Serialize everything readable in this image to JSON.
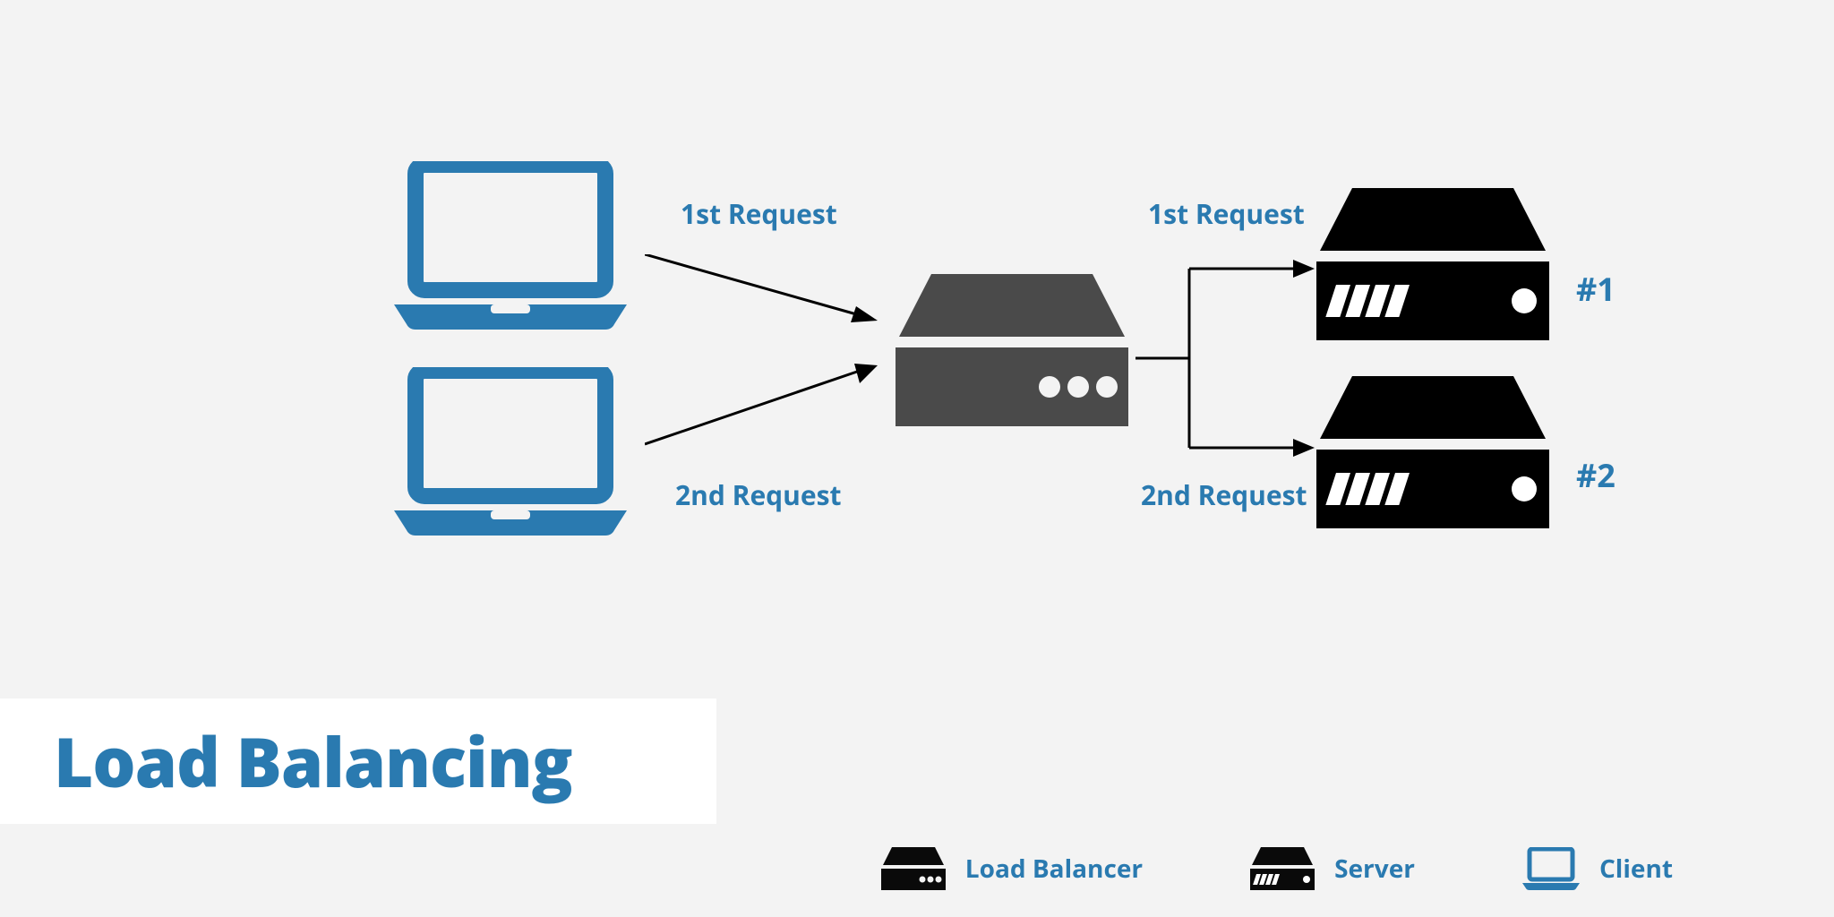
{
  "title": "Load Balancing",
  "arrows": {
    "left_top_label": "1st Request",
    "left_bottom_label": "2nd Request",
    "right_top_label": "1st Request",
    "right_bottom_label": "2nd Request"
  },
  "servers": {
    "num1": "#1",
    "num2": "#2"
  },
  "legend": {
    "load_balancer": "Load Balancer",
    "server": "Server",
    "client": "Client"
  },
  "colors": {
    "accent": "#2a7ab0",
    "lb": "#4a4a4a",
    "server": "#000000",
    "bg": "#f3f3f3"
  }
}
